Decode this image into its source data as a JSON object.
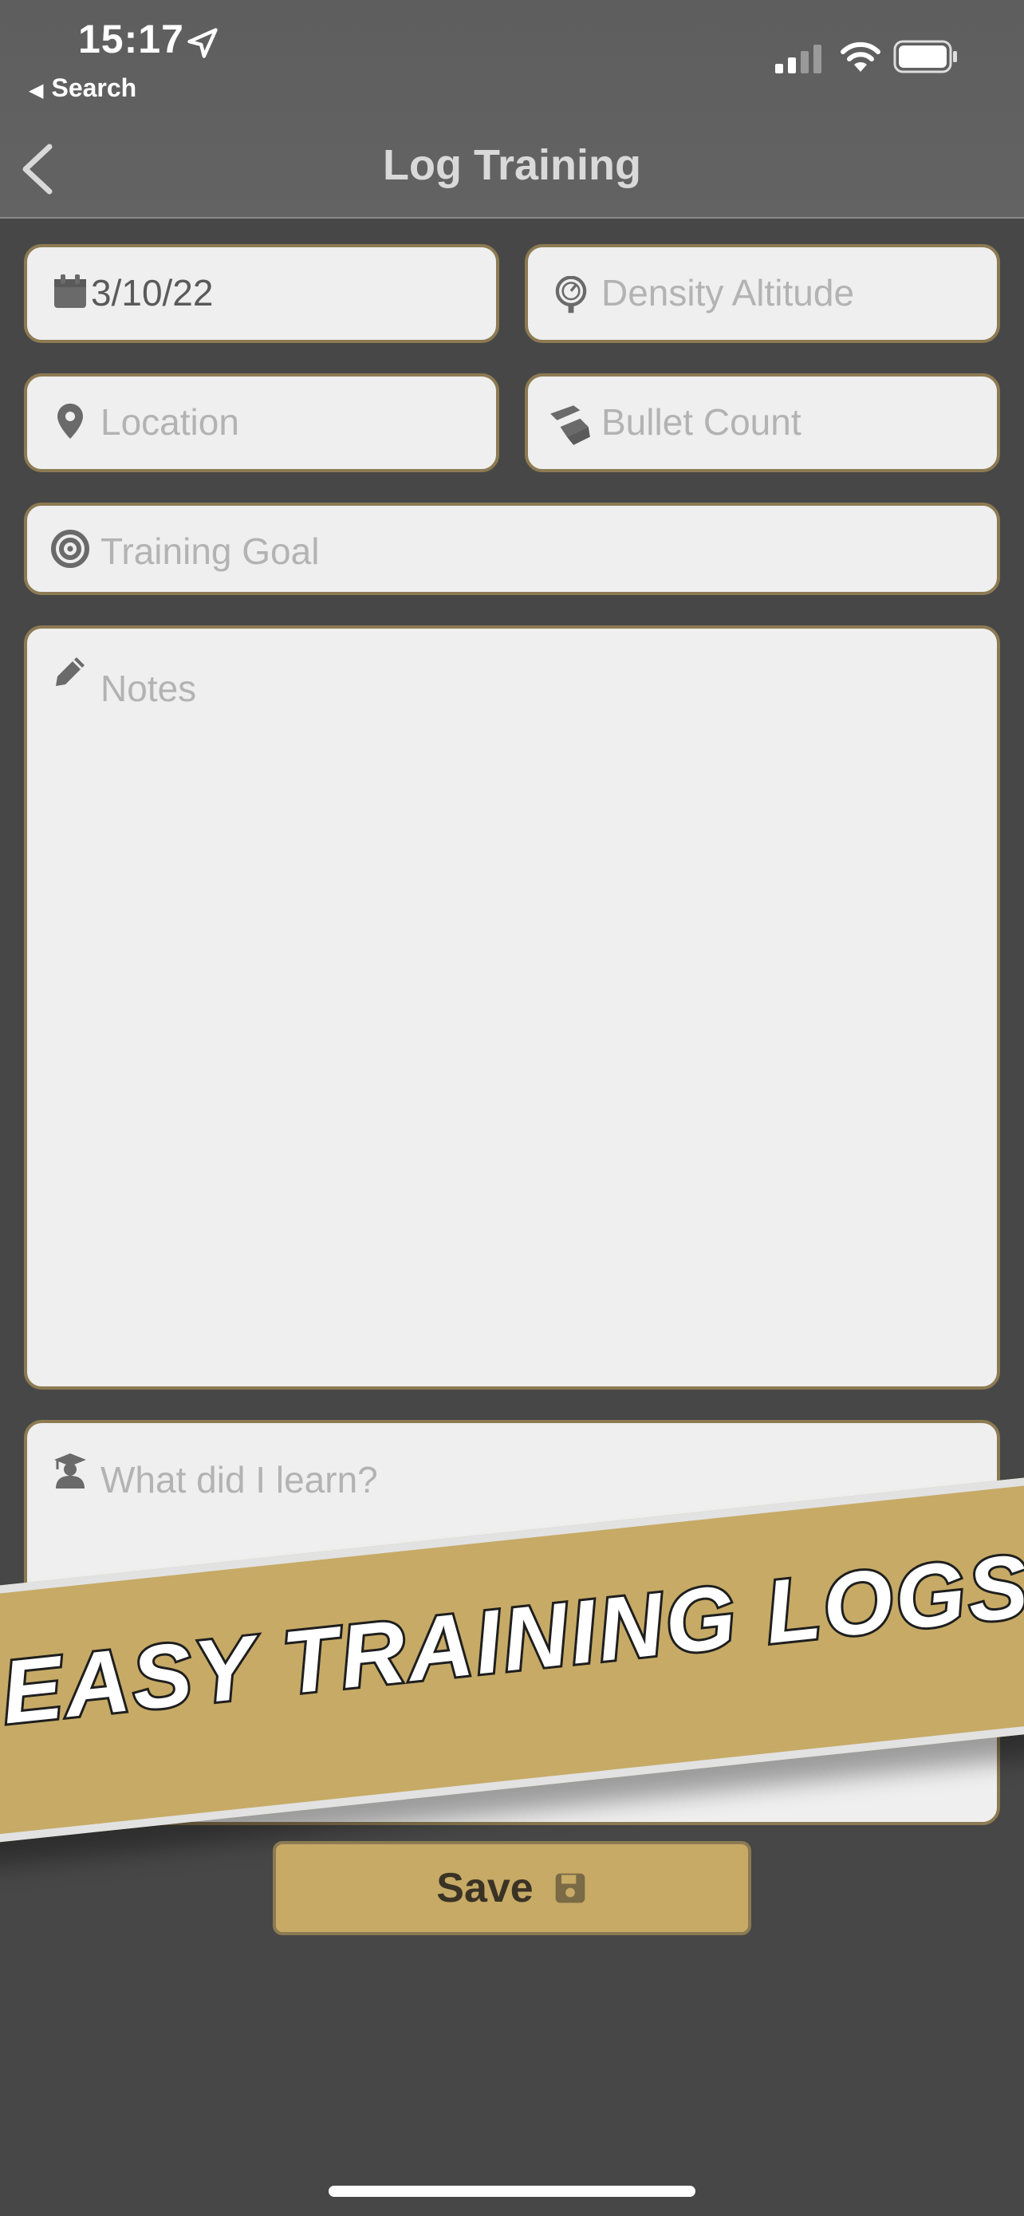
{
  "status_bar": {
    "time": "15:17",
    "back_app_label": "Search"
  },
  "nav": {
    "title": "Log Training"
  },
  "form": {
    "date_value": "3/10/22",
    "density_altitude_placeholder": "Density Altitude",
    "location_placeholder": "Location",
    "bullet_count_placeholder": "Bullet Count",
    "training_goal_placeholder": "Training Goal",
    "notes_placeholder": "Notes",
    "learned_placeholder": "What did I learn?"
  },
  "banner": {
    "text": "EASY TRAINING LOGS"
  },
  "actions": {
    "save_label": "Save"
  },
  "icons": {
    "date": "calendar-icon",
    "density_altitude": "gauge-icon",
    "location": "map-pin-icon",
    "bullet_count": "bullets-icon",
    "training_goal": "target-icon",
    "notes": "pencil-icon",
    "learned": "graduate-icon",
    "save": "floppy-disk-icon"
  },
  "colors": {
    "accent": "#c6aa66",
    "field_border": "#8c7a52",
    "background": "#474747",
    "field_bg": "#efefef"
  }
}
